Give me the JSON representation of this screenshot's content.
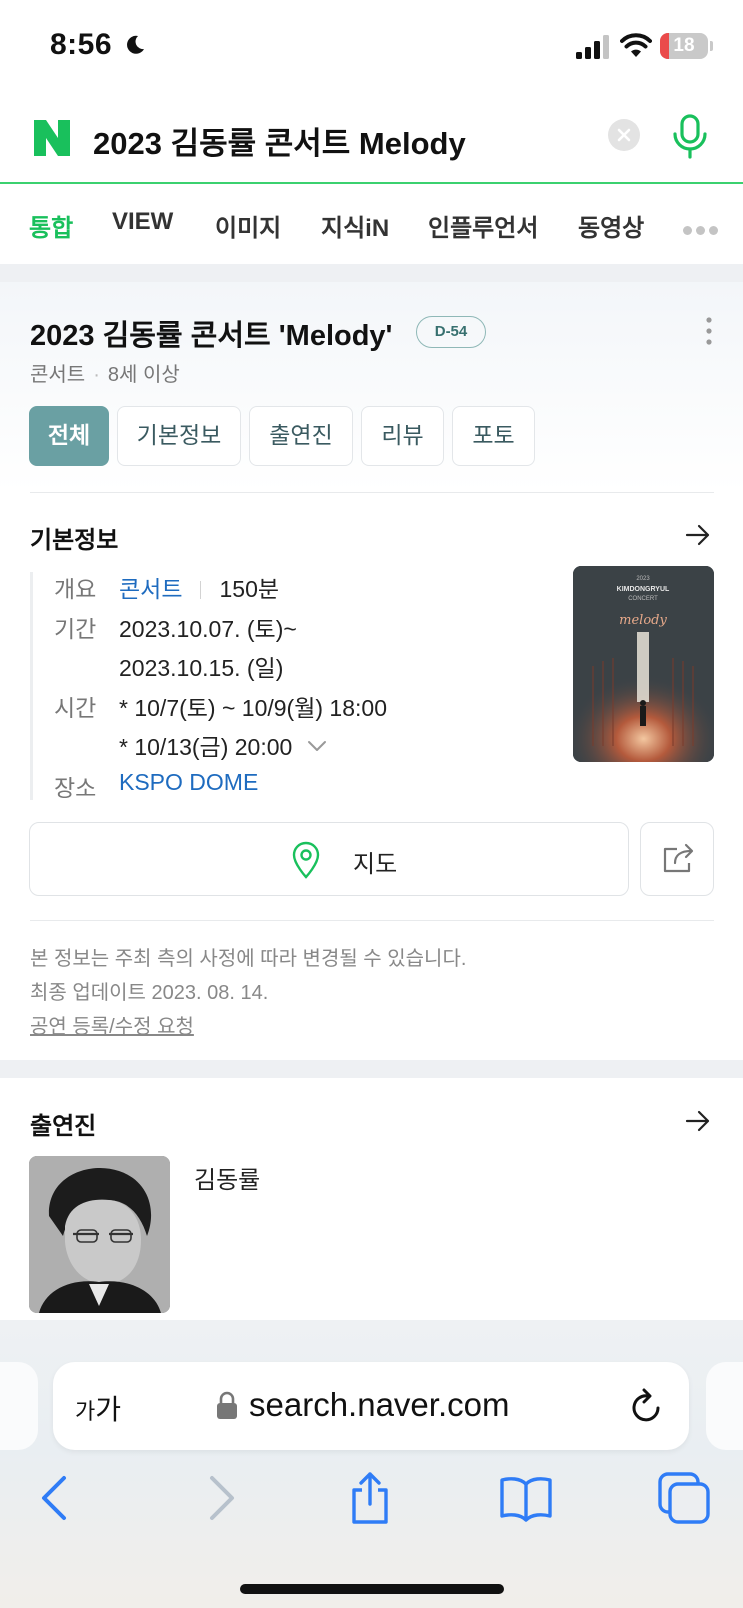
{
  "status_bar": {
    "time": "8:56",
    "battery": "18",
    "battery_level_percent": 18
  },
  "search": {
    "query": "2023 김동률 콘서트 Melody",
    "logo": "N"
  },
  "tabs": [
    {
      "label": "통합",
      "active": true
    },
    {
      "label": "VIEW",
      "active": false
    },
    {
      "label": "이미지",
      "active": false
    },
    {
      "label": "지식iN",
      "active": false
    },
    {
      "label": "인플루언서",
      "active": false
    },
    {
      "label": "동영상",
      "active": false
    }
  ],
  "concert": {
    "title": "2023 김동률 콘서트 'Melody'",
    "dday": "D-54",
    "genre": "콘서트",
    "age": "8세 이상",
    "filters": [
      "전체",
      "기본정보",
      "출연진",
      "리뷰",
      "포토"
    ]
  },
  "basic_info": {
    "section_title": "기본정보",
    "overview_label": "개요",
    "overview_genre": "콘서트",
    "overview_duration": "150분",
    "period_label": "기간",
    "period_start": "2023.10.07. (토)~",
    "period_end": "2023.10.15. (일)",
    "time_label": "시간",
    "time_1": "* 10/7(토) ~ 10/9(월) 18:00",
    "time_2": "* 10/13(금) 20:00",
    "venue_label": "장소",
    "venue": "KSPO DOME",
    "poster_year": "2023",
    "poster_artist": "KIMDONGRYUL",
    "poster_sub": "CONCERT",
    "poster_title": "melody",
    "map_label": "지도",
    "note": "본 정보는 주최 측의 사정에 따라 변경될 수 있습니다.",
    "updated": "최종 업데이트 2023. 08. 14.",
    "edit_link": "공연 등록/수정 요청"
  },
  "performers": {
    "section_title": "출연진",
    "items": [
      {
        "name": "김동률"
      }
    ]
  },
  "safari": {
    "aa_large": "가",
    "aa_small": "가",
    "url": "search.naver.com"
  },
  "colors": {
    "naver_green": "#19c05c",
    "accent_teal": "#6aa0a3",
    "link_blue": "#1e6bbf",
    "ios_blue": "#2f7cf6"
  },
  "icons": [
    "moon-icon",
    "signal-icon",
    "wifi-icon",
    "clear-icon",
    "mic-icon",
    "more-icon",
    "arrow-right-icon",
    "map-pin-icon",
    "share-icon",
    "lock-icon",
    "reload-icon",
    "back-icon",
    "forward-icon",
    "share-sheet-icon",
    "bookmarks-icon",
    "tabs-icon"
  ]
}
